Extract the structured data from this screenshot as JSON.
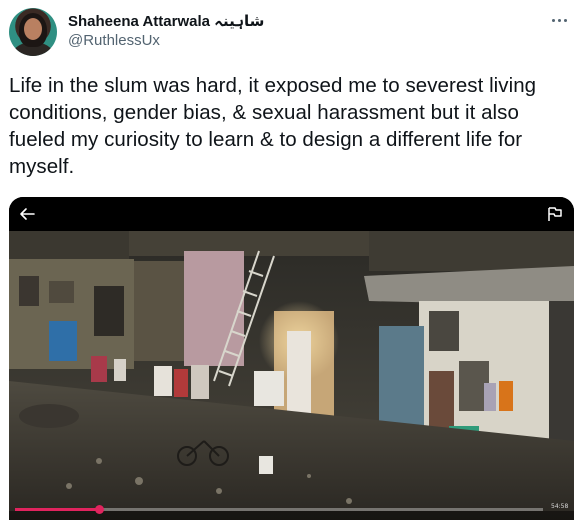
{
  "tweet": {
    "author_name": "Shaheena Attarwala شاہینہ",
    "author_handle": "@RuthlessUx",
    "text": "Life in the slum was hard, it exposed me to severest living conditions, gender bias, & sexual harassment but it also fueled my curiosity to learn & to design a different life for myself.",
    "more_icon": "more-horizontal-icon"
  },
  "media": {
    "type": "video",
    "back_icon": "back-arrow-icon",
    "report_icon": "flag-icon",
    "progress": 0.16,
    "time_label": "54:58",
    "accent_color": "#e0245e"
  }
}
